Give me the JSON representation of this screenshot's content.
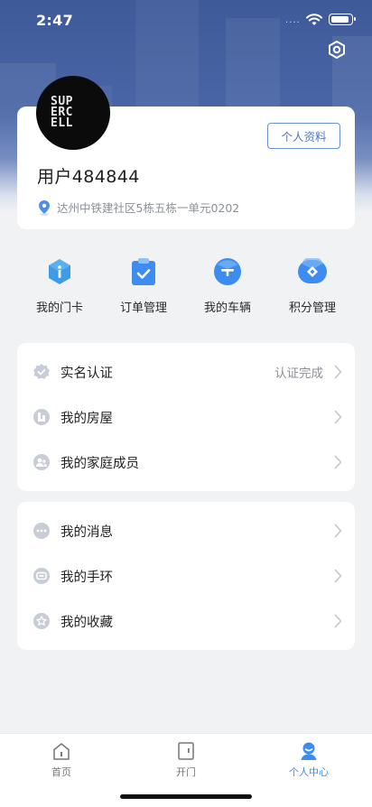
{
  "status_bar": {
    "time": "2:47",
    "signal_dots": "····"
  },
  "header": {
    "settings_icon": "hexagon-settings-icon"
  },
  "profile": {
    "avatar_logo_lines": [
      "SUP",
      "ERC",
      "ELL"
    ],
    "edit_profile_label": "个人资料",
    "username": "用户484844",
    "address": "达州中铁建社区5栋五栋一单元0202"
  },
  "quick_actions": [
    {
      "label": "我的门卡",
      "icon": "door-card-icon",
      "color": "#3f9ae8"
    },
    {
      "label": "订单管理",
      "icon": "order-clipboard-icon",
      "color": "#3f8cf0"
    },
    {
      "label": "我的车辆",
      "icon": "vehicle-icon",
      "color": "#3f8cf0"
    },
    {
      "label": "积分管理",
      "icon": "points-diamond-icon",
      "color": "#3f8cf0"
    }
  ],
  "group1": [
    {
      "label": "实名认证",
      "value": "认证完成",
      "icon": "verified-badge-icon"
    },
    {
      "label": "我的房屋",
      "value": "",
      "icon": "house-icon"
    },
    {
      "label": "我的家庭成员",
      "value": "",
      "icon": "family-members-icon"
    }
  ],
  "group2": [
    {
      "label": "我的消息",
      "value": "",
      "icon": "message-icon"
    },
    {
      "label": "我的手环",
      "value": "",
      "icon": "wristband-icon"
    },
    {
      "label": "我的收藏",
      "value": "",
      "icon": "star-icon"
    }
  ],
  "tabbar": [
    {
      "label": "首页",
      "icon": "home-icon",
      "active": false
    },
    {
      "label": "开门",
      "icon": "door-open-icon",
      "active": false
    },
    {
      "label": "个人中心",
      "icon": "person-center-icon",
      "active": true
    }
  ],
  "colors": {
    "accent": "#3f8cf0",
    "header_blue": "#4a66a6",
    "muted_icon": "#c7ccd6"
  }
}
